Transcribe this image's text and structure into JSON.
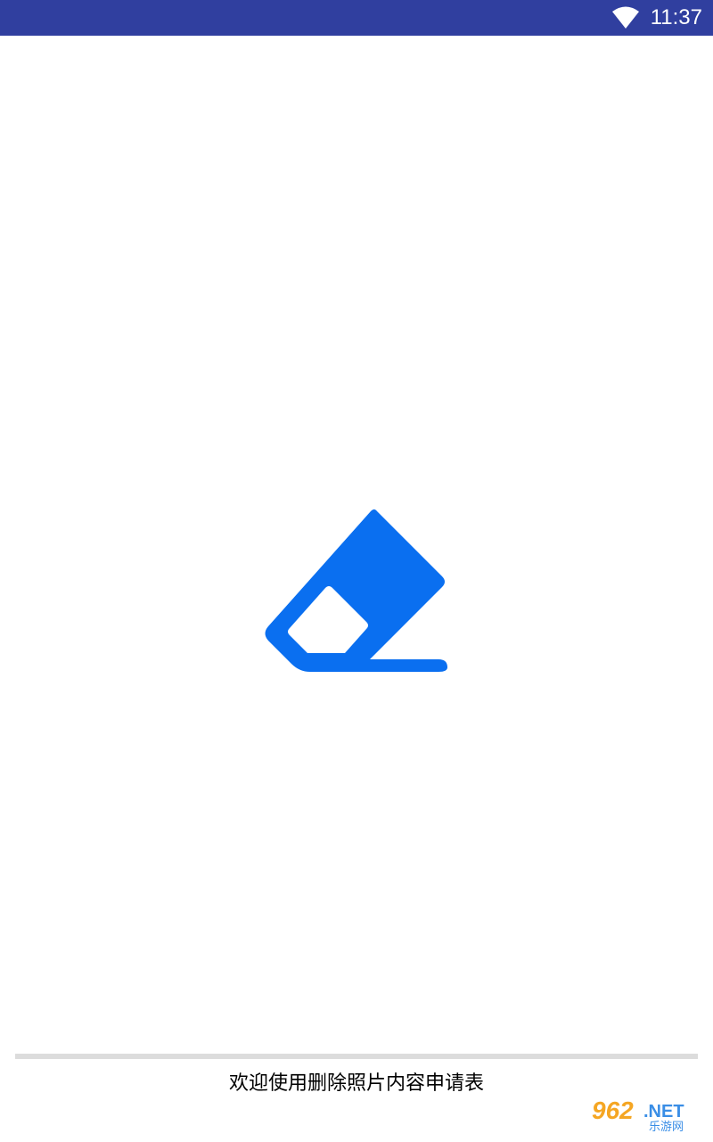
{
  "status_bar": {
    "time": "11:37",
    "icons": [
      "wifi-icon"
    ],
    "background_color": "#303f9f"
  },
  "splash": {
    "logo_icon": "eraser-icon",
    "logo_color": "#0a6ff0",
    "progress_fraction": 0.0,
    "welcome_text": "欢迎使用删除照片内容申请表"
  },
  "watermark": {
    "main_text": "962",
    "suffix_text": ".NET",
    "sub_text": "乐游网"
  }
}
